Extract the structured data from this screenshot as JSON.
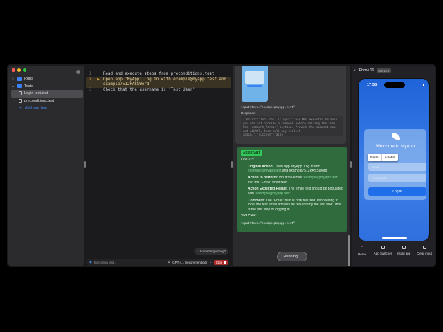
{
  "window": {
    "traffic_lights": [
      "#ff5f57",
      "#febc2e",
      "#28c840"
    ]
  },
  "sidebar": {
    "items": [
      {
        "label": "Runs",
        "kind": "folder",
        "indent": 0
      },
      {
        "label": "Tests",
        "kind": "folder",
        "indent": 0
      },
      {
        "label": "Login test.test",
        "kind": "file",
        "indent": 1,
        "selected": true
      },
      {
        "label": "preconditions.test",
        "kind": "file",
        "indent": 1
      }
    ],
    "add_label": "Add new test"
  },
  "editor": {
    "lines": [
      {
        "num": "1",
        "text": "Read and execute steps from preconditions.test",
        "active": false
      },
      {
        "num": "2",
        "text": "Open app 'MyApp' Log in with example@myapp.test and\nexample7512PASSWord",
        "active": true
      },
      {
        "num": "3",
        "text": "Check that the username is 'Test User'",
        "active": false
      }
    ],
    "something_wrong": "Something wrong?",
    "input_placeholder": "Executing test...",
    "model": "GPT-4.1 (recommended)",
    "stop_label": "Stop"
  },
  "chat": {
    "tool_call": "input(text=\"example@myapp.test\")",
    "response_label": "Response:",
    "response_text": "{\"error\":\"Tool call \\\"input\\\" was NOT executed because you did not provide a comment before calling the tool. Use 'comment_format' section. Provide the comment now and ALWAYS, then call any toolist again.\",\"success\":false}",
    "assistant_badge": "ASSISTANT",
    "line_ref": "Line 2/3:",
    "bullets": [
      {
        "label": "Original Action:",
        "text": "Open app 'MyApp' Log in with ",
        "em": "example@myapp.test",
        "tail": " and example7512PASSWord"
      },
      {
        "label": "Action to perform:",
        "text": "Input the email \"",
        "em": "example@myapp.test",
        "tail": "\" into the \"Email\" input field"
      },
      {
        "label": "Action Expected Result:",
        "text": "The email field should be populated with \"",
        "em": "example@myapp.test",
        "tail": "\""
      },
      {
        "label": "Comment:",
        "text": "The \"Email\" field is now focused. Proceeding to input the test email address as required by the test flow. This is the first step of logging in.",
        "em": "",
        "tail": ""
      }
    ],
    "tool_calls_label": "Tool Calls:",
    "tool_calls_text": "input(text=\"example@myapp.test\")",
    "running_label": "Running..."
  },
  "device": {
    "name": "iPhone 16",
    "os": "iOS 18.0",
    "time": "17:58",
    "welcome": "Welcome to MyApp",
    "email_placeholder": "Email",
    "password_placeholder": "Password",
    "login_label": "Log in",
    "popup": [
      "Paste",
      "AutoFill"
    ],
    "toolbar": [
      {
        "label": "Home",
        "icon": "home-icon"
      },
      {
        "label": "App Switcher",
        "icon": "app-switcher-icon"
      },
      {
        "label": "Install app",
        "icon": "install-icon"
      },
      {
        "label": "Clear input",
        "icon": "clear-icon"
      }
    ]
  }
}
